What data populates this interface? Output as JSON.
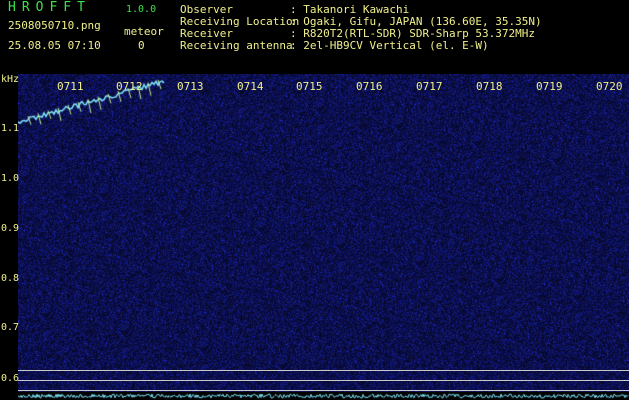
{
  "header": {
    "app_title": "HROFFT",
    "app_version": "1.0.0",
    "file_name": "2508050710.png",
    "meteor_label": "meteor",
    "datetime": "25.08.05 07:10",
    "meteor_count": "0",
    "info": [
      {
        "label": "Observer",
        "value": ": Takanori Kawachi"
      },
      {
        "label": "Receiving Location",
        "value": ": Ogaki, Gifu, JAPAN (136.60E, 35.35N)"
      },
      {
        "label": "Receiver",
        "value": ": R820T2(RTL-SDR) SDR-Sharp 53.372MHz"
      },
      {
        "label": "Receiving antenna",
        "value": ": 2el-HB9CV Vertical (el. E-W)"
      }
    ]
  },
  "axis": {
    "unit": "kHz",
    "time_ticks": [
      "0711",
      "0712",
      "0713",
      "0714",
      "0715",
      "0716",
      "0717",
      "0718",
      "0719",
      "0720"
    ],
    "freq_ticks": [
      "1.1",
      "1.0",
      "0.9",
      "0.8",
      "0.7",
      "0.6"
    ]
  },
  "colors": {
    "background": "#07073a",
    "trace": "#7fe6ff",
    "header_text": "#f0f08c",
    "title_text": "#3ee04a",
    "grid_line": "#c8c8c8"
  }
}
